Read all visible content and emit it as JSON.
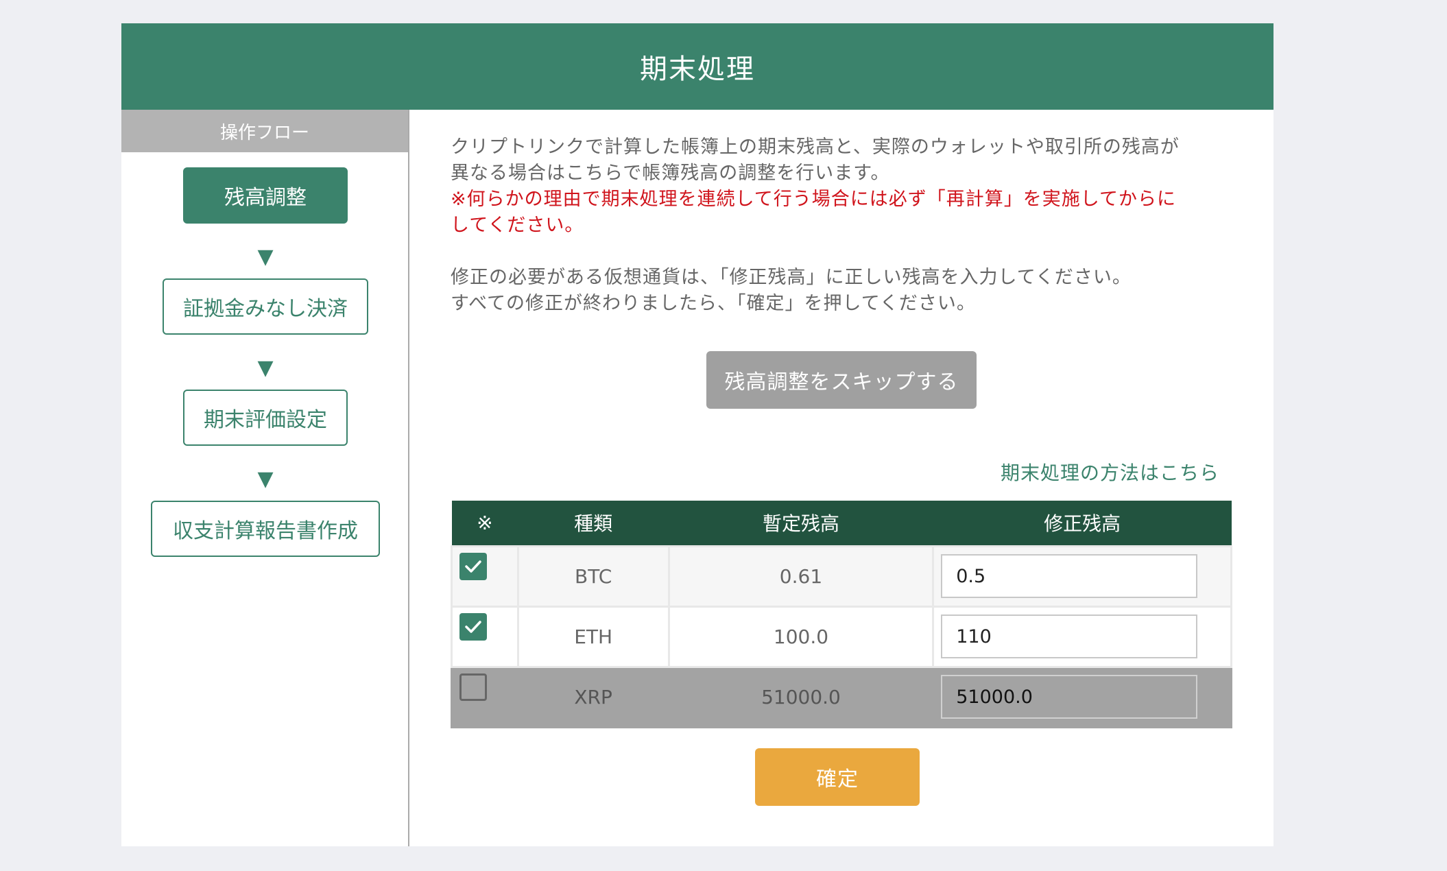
{
  "header": {
    "title": "期末処理"
  },
  "sidebar": {
    "title": "操作フロー",
    "steps": [
      {
        "label": "残高調整",
        "active": true
      },
      {
        "label": "証拠金みなし決済",
        "active": false
      },
      {
        "label": "期末評価設定",
        "active": false
      },
      {
        "label": "収支計算報告書作成",
        "active": false
      }
    ],
    "arrow": "▼"
  },
  "main": {
    "intro_line1": "クリプトリンクで計算した帳簿上の期末残高と、実際のウォレットや取引所の残高が",
    "intro_line2": "異なる場合はこちらで帳簿残高の調整を行います。",
    "warning_line1": "※何らかの理由で期末処理を連続して行う場合には必ず「再計算」を実施してからに",
    "warning_line2": "してください。",
    "instruction_line1": "修正の必要がある仮想通貨は、「修正残高」に正しい残高を入力してください。",
    "instruction_line2": "すべての修正が終わりましたら、「確定」を押してください。",
    "skip_button": "残高調整をスキップする",
    "how_link": "期末処理の方法はこちら",
    "confirm_button": "確定"
  },
  "table": {
    "headers": [
      "※",
      "種類",
      "暫定残高",
      "修正残高"
    ],
    "rows": [
      {
        "checked": true,
        "type": "BTC",
        "provisional": "0.61",
        "corrected": "0.5"
      },
      {
        "checked": true,
        "type": "ETH",
        "provisional": "100.0",
        "corrected": "110"
      },
      {
        "checked": false,
        "type": "XRP",
        "provisional": "51000.0",
        "corrected": "51000.0"
      }
    ]
  },
  "colors": {
    "brand_green": "#3b836c",
    "table_header": "#22533f",
    "warning_red": "#d0141c",
    "confirm_orange": "#eaa83e",
    "skip_gray": "#a0a0a0"
  }
}
